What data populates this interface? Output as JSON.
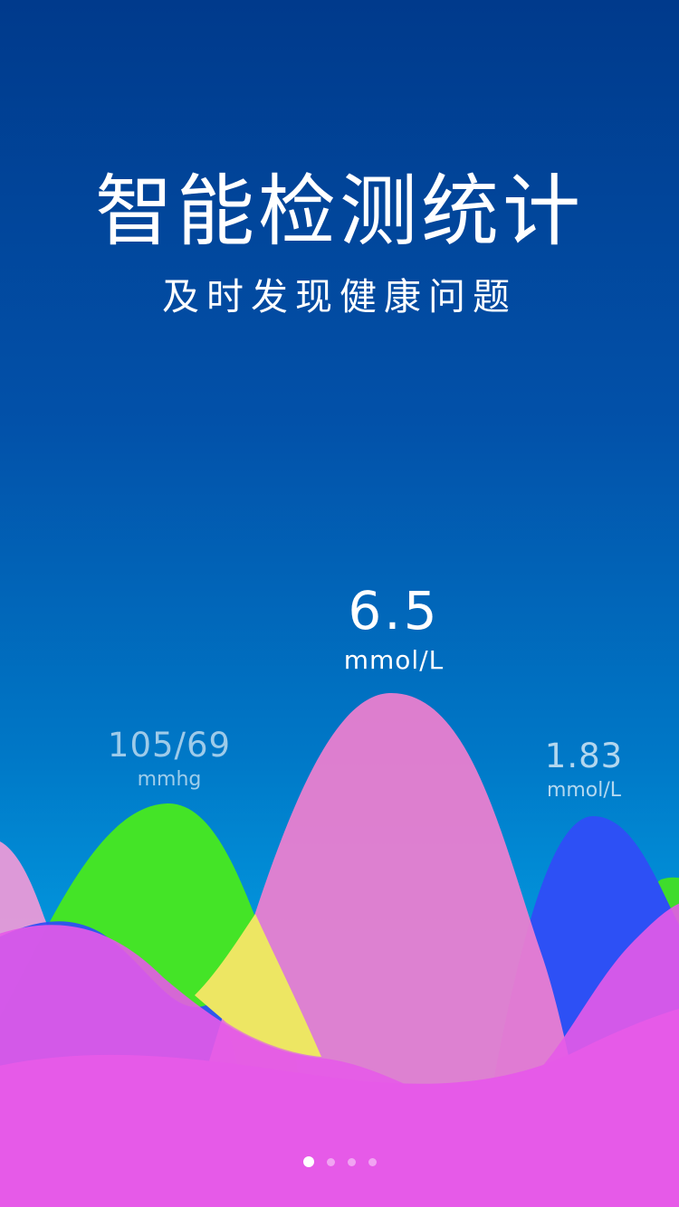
{
  "hero": {
    "title": "智能检测统计",
    "subtitle": "及时发现健康问题"
  },
  "metrics": [
    {
      "key": "blood-pressure",
      "value": "105/69",
      "unit": "mmhg",
      "wave_color": "#44e427"
    },
    {
      "key": "blood-glucose",
      "value": "6.5",
      "unit": "mmol/L",
      "wave_color": "#f07fcf"
    },
    {
      "key": "blood-lipid",
      "value": "1.83",
      "unit": "mmol/L",
      "wave_color": "#2d50f5"
    }
  ],
  "colors": {
    "background_top": "#003a8c",
    "background_bottom": "#03a4e8",
    "magenta_wave": "#e65ae8",
    "overlap_yellow": "#ede663"
  },
  "pager": {
    "pages": 4,
    "active_index": 0
  }
}
